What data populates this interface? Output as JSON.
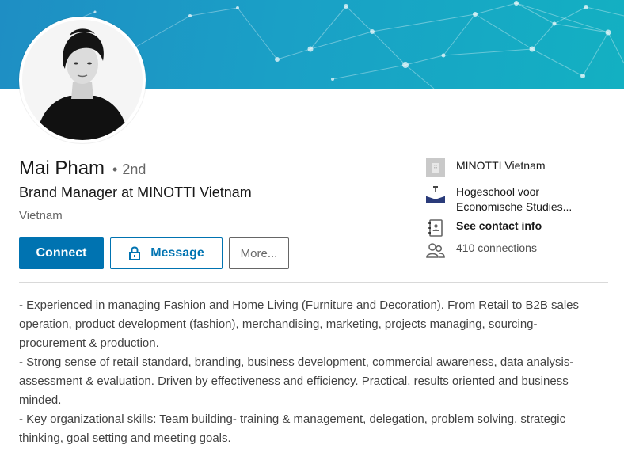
{
  "profile": {
    "name": "Mai Pham",
    "degree_separator": "•",
    "degree": "2nd",
    "headline": "Brand Manager at MINOTTI Vietnam",
    "location": "Vietnam"
  },
  "actions": {
    "connect_label": "Connect",
    "message_label": "Message",
    "more_label": "More..."
  },
  "sidebar": {
    "company": "MINOTTI Vietnam",
    "school_line1": "Hogeschool voor",
    "school_line2": "Economische Studies...",
    "contact": "See contact info",
    "connections": "410 connections"
  },
  "summary": {
    "lines": [
      "- Experienced in managing Fashion and Home Living (Furniture and Decoration). From Retail to B2B sales",
      "operation, product development (fashion), merchandising, marketing, projects managing, sourcing-",
      "procurement & production.",
      "- Strong sense of retail standard, branding, business development, commercial awareness, data analysis-",
      "assessment & evaluation. Driven by effectiveness and efficiency. Practical, results oriented and business",
      "minded.",
      "- Key organizational skills: Team building- training & management, delegation, problem solving, strategic",
      "thinking, goal setting and meeting goals."
    ]
  },
  "colors": {
    "primary": "#0073b1",
    "banner_start": "#1e8ec4",
    "banner_end": "#13b0c2"
  },
  "icons": [
    "company-logo-icon",
    "school-logo-icon",
    "contact-card-icon",
    "connections-icon",
    "lock-icon"
  ]
}
